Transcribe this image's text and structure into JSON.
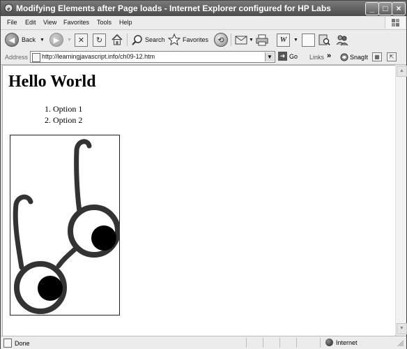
{
  "window": {
    "title": "Modifying Elements after Page loads - Internet Explorer configured for HP Labs",
    "controls": [
      "_",
      "□",
      "×"
    ]
  },
  "menu": [
    "File",
    "Edit",
    "View",
    "Favorites",
    "Tools",
    "Help"
  ],
  "toolbar": {
    "back_label": "Back",
    "search_label": "Search",
    "favorites_label": "Favorites"
  },
  "address": {
    "label": "Address",
    "url": "http://learningjavascript.info/ch09-12.htm",
    "go_label": "Go",
    "links_label": "Links",
    "chevron": "»",
    "snagit_label": "SnagIt"
  },
  "page": {
    "heading": "Hello World",
    "options": [
      "Option 1",
      "Option 2"
    ]
  },
  "status": {
    "text": "Done",
    "zone": "Internet"
  }
}
